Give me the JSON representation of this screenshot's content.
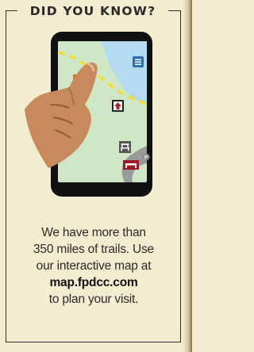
{
  "heading": "DID YOU KNOW?",
  "caption": {
    "line1": "We have more than",
    "line2": "350 miles of trails. Use",
    "line3": "our interactive map at",
    "url": "map.fpdcc.com",
    "line5": "to plan your visit."
  },
  "colors": {
    "background": "#f3ecd0",
    "phone_body": "#111111",
    "map_land": "#cfe7c6",
    "map_water": "#b5dbf1",
    "trail_yellow": "#f1de39",
    "road_gray": "#9a9a9a",
    "hand": "#c68a5c",
    "star_marker": "#e06a3a",
    "menu_button": "#2b6fb7"
  },
  "icons": [
    "star-marker-icon",
    "menu-icon",
    "home-marker-icon",
    "picnic-table-icon",
    "parking-icon",
    "bench-icon",
    "finger-pointer-hand"
  ]
}
